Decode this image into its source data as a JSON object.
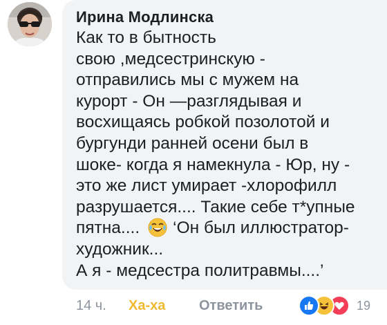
{
  "comment": {
    "author": "Ирина Модлинска",
    "lines": [
      "Как то в бытность",
      "свою ,медсестринскую -",
      "отправились мы с мужем на",
      "курорт - Он —разглядывая и",
      "восхищаясь робкой позолотой и",
      "бургунди ранней осени был в",
      "шоке- когда я намекнула - Юр, ну -",
      "это же лист умирает -хлорофилл",
      "разрушается.... Такие себе т*упные"
    ],
    "line_with_emoji_before": "пятна....",
    "line_with_emoji_after": "‘Он был иллюстратор-",
    "lines_after": [
      "художник...",
      "А я - медсестра политравмы....’"
    ]
  },
  "footer": {
    "time": "14 ч.",
    "haha_label": "Ха-ха",
    "reply_label": "Ответить",
    "reaction_count": "19"
  },
  "icons": {
    "avatar": "avatar",
    "inline_emoji": "crying-laughing-emoji-icon",
    "reactions": [
      "like-reaction-icon",
      "haha-reaction-icon",
      "love-reaction-icon"
    ]
  },
  "colors": {
    "bubble_bg": "#f2f3f5",
    "text": "#1c1e21",
    "muted": "#8d949e",
    "haha": "#f0b92f",
    "like_blue": "#1877f2",
    "love_red": "#f33e58"
  }
}
